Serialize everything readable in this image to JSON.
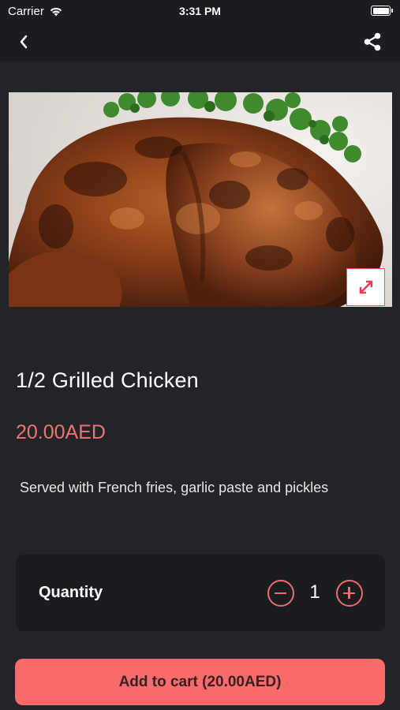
{
  "status_bar": {
    "carrier": "Carrier",
    "time": "3:31 PM"
  },
  "nav": {
    "back_icon": "chevron-left-icon",
    "share_icon": "share-icon"
  },
  "product": {
    "image_subject": "grilled-chicken-photo",
    "expand_icon": "expand-arrows-icon",
    "title": "1/2 Grilled Chicken",
    "price": "20.00AED",
    "description": "Served with French fries, garlic paste and pickles"
  },
  "quantity": {
    "label": "Quantity",
    "value": "1",
    "minus_icon": "minus-circle-icon",
    "plus_icon": "plus-circle-icon"
  },
  "cart_button": {
    "label": "Add to cart (20.00AED)"
  },
  "colors": {
    "background": "#232427",
    "bar": "#1c1d20",
    "accent": "#fa6b6b",
    "price": "#f07373"
  }
}
